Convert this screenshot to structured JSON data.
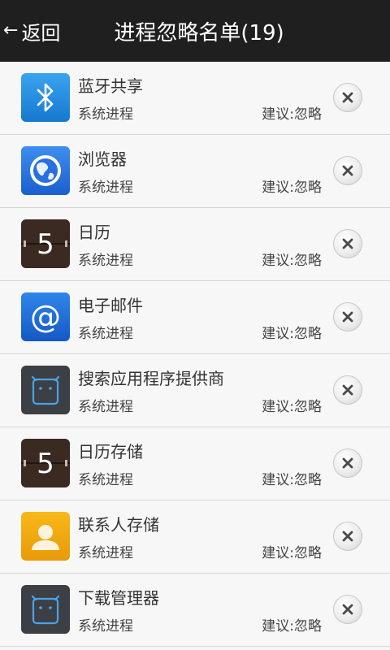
{
  "header": {
    "back_label": "返回",
    "title": "进程忽略名单(19)"
  },
  "colors": {
    "topbar": "#1f1f1f",
    "background": "#f7f7f7"
  },
  "items": [
    {
      "name": "蓝牙共享",
      "type": "系统进程",
      "suggestion": "建议:忽略",
      "icon": "bluetooth-icon"
    },
    {
      "name": "浏览器",
      "type": "系统进程",
      "suggestion": "建议:忽略",
      "icon": "browser-globe-icon"
    },
    {
      "name": "日历",
      "type": "系统进程",
      "suggestion": "建议:忽略",
      "icon": "calendar-icon",
      "icon_text": "5"
    },
    {
      "name": "电子邮件",
      "type": "系统进程",
      "suggestion": "建议:忽略",
      "icon": "email-at-icon",
      "icon_text": "@"
    },
    {
      "name": "搜索应用程序提供商",
      "type": "系统进程",
      "suggestion": "建议:忽略",
      "icon": "android-robot-icon"
    },
    {
      "name": "日历存储",
      "type": "系统进程",
      "suggestion": "建议:忽略",
      "icon": "calendar-icon",
      "icon_text": "5"
    },
    {
      "name": "联系人存储",
      "type": "系统进程",
      "suggestion": "建议:忽略",
      "icon": "contacts-person-icon"
    },
    {
      "name": "下载管理器",
      "type": "系统进程",
      "suggestion": "建议:忽略",
      "icon": "android-robot-icon"
    }
  ]
}
